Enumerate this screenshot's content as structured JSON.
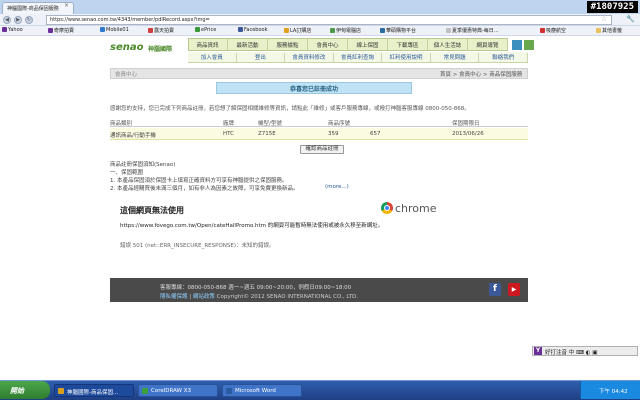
{
  "browser": {
    "tab_title": "神腦國際-商品保固服務",
    "tab_close": "×",
    "watermark": "#1807925",
    "url": "https://www.senao.com.tw/4343/member/pdlRecord.aspx?img=",
    "back_glyph": "◀",
    "forward_glyph": "▶",
    "reload_glyph": "↻",
    "star_glyph": "☆",
    "wrench_glyph": "🔧",
    "bookmarks": [
      {
        "label": "Yahoo",
        "color": "#6b2f9a"
      },
      {
        "label": "奇摩拍賣",
        "color": "#6b2f9a"
      },
      {
        "label": "Mobile01",
        "color": "#2e7bd1"
      },
      {
        "label": "露天拍賣",
        "color": "#d13e3e"
      },
      {
        "label": "ePrice",
        "color": "#3a9a3a"
      },
      {
        "label": "Facebook",
        "color": "#3b5998"
      },
      {
        "label": "LA訂購店",
        "color": "#e0a020"
      },
      {
        "label": "伊甸電腦店",
        "color": "#4a9a4a"
      },
      {
        "label": "華碩購物平台",
        "color": "#2a6aa0"
      },
      {
        "label": "夏季優惠特典-每日...",
        "color": "#c0c0c0"
      },
      {
        "label": "吸塵航空",
        "color": "#d03030"
      }
    ],
    "other_bookmarks": "其他書籤"
  },
  "header": {
    "logo_text": "senao",
    "logo_sub": "神腦國際",
    "top_nav": [
      "商品資訊",
      "最新活動",
      "服務據點",
      "會員中心",
      "線上保固",
      "下載專區",
      "個人生活誌",
      "網頁導覽"
    ],
    "sub_nav": [
      "加入會員",
      "登出",
      "會員資料修改",
      "會員紅利查詢",
      "紅利使用說明",
      "常見問題",
      "聯絡我們"
    ]
  },
  "member_bar": {
    "label": "會員中心",
    "breadcrumb": "首頁 > 會員中心 > 商品保固服務"
  },
  "success_message": "恭喜您已註冊成功",
  "intro_text": "感謝您的支持，您已完成下列商品註冊，若您想了解保固相關維修等資訊，請點此「維修」或客戶服務專線，或撥打神腦客服專線 0800-050-868。",
  "table": {
    "headers": [
      "商品類別",
      "廠牌",
      "機型/型號",
      "商品序號",
      "",
      "保固期限日"
    ],
    "rows": [
      {
        "category": "通訊商品/行動手機",
        "brand": "HTC",
        "model": "Z715E",
        "serial1": "359",
        "serial2": "657",
        "warranty_date": "2013/06/26"
      }
    ]
  },
  "confirm_button": "確認商品註冊",
  "notice": {
    "title": "商品註冊保固須知(Senao)",
    "items": [
      "一、保固範圍",
      "1. 本產品保固須於保固卡上填寫正確資料方可享有神腦提供之保固服務。",
      "2. 本產品經購買後未滿三個月，如有非人為因素之故障，可享免費更換新品。"
    ],
    "more": "(more...)"
  },
  "error_panel": {
    "title": "這個網頁無法使用",
    "chrome_word": "chrome",
    "description": "https://www.fovego.com.tw/Open/cateHallPromo.htm 的網頁可能暫時無法使用或被永久移至新網址。",
    "code": "錯誤 501 (net::ERR_INSECURE_RESPONSE)：未知的錯誤。"
  },
  "footer": {
    "line1": "客服專線：0800-050-868 週一~週五 09:00~20:00，例假日09:00~18:00",
    "privacy": "隱私權保護",
    "terms": "網站政策",
    "copyright": "Copyright© 2012 SENAO INTERNATIONAL CO., LTD."
  },
  "ime": {
    "text": "好打注音 中 ⌨ ◐ ▣"
  },
  "taskbar": {
    "start": "開始",
    "tasks": [
      {
        "label": "神腦國際-商品保固...",
        "color": "#d9a020",
        "active": true
      },
      {
        "label": "CorelDRAW X3",
        "color": "#3aa03a",
        "active": false
      },
      {
        "label": "Microsoft Word",
        "color": "#2a5aa0",
        "active": false
      }
    ],
    "clock": "下午 04:42"
  },
  "colors": {
    "accent_green": "#4a8a2a",
    "success_bg": "#bfe3f5",
    "footer_bg": "#4a4a4a"
  }
}
